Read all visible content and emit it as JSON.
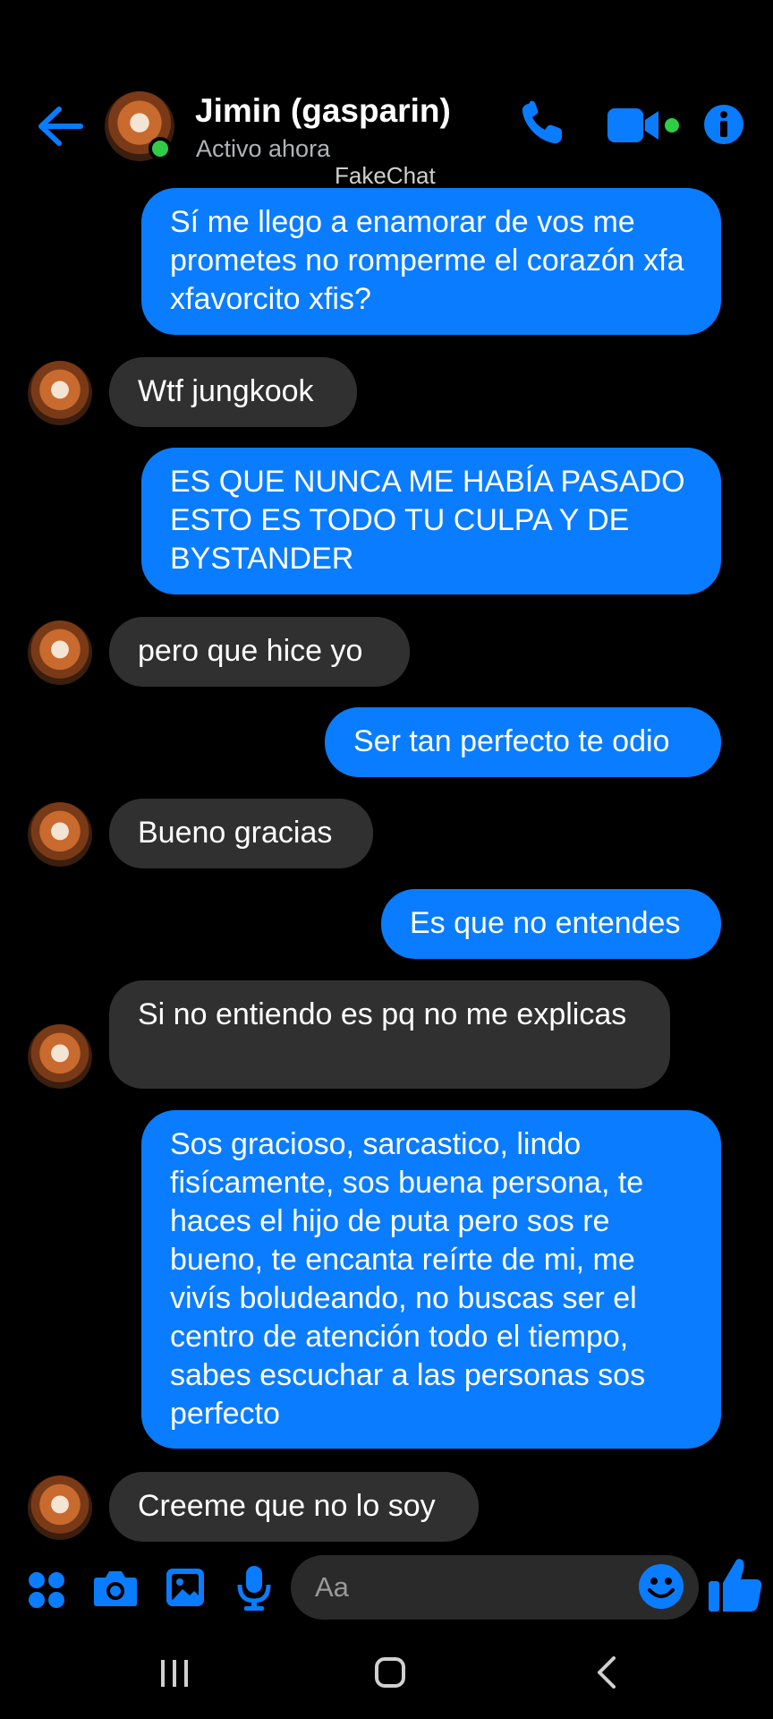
{
  "header": {
    "contact_name": "Jimin (gasparin)",
    "status": "Activo ahora",
    "watermark": "FakeChat"
  },
  "messages": [
    {
      "dir": "sent",
      "text": "Sí me llego a enamorar de vos me prometes no romperme el corazón xfa xfavorcito xfis?"
    },
    {
      "dir": "recv",
      "text": "Wtf jungkook"
    },
    {
      "dir": "sent",
      "text": "ES QUE NUNCA ME HABÍA PASADO ESTO ES TODO TU CULPA Y DE BYSTANDER"
    },
    {
      "dir": "recv",
      "text": "pero que hice yo"
    },
    {
      "dir": "sent",
      "text": "Ser tan perfecto te odio"
    },
    {
      "dir": "recv",
      "text": "Bueno gracias"
    },
    {
      "dir": "sent",
      "text": "Es que no entendes"
    },
    {
      "dir": "recv",
      "text": "Si no entiendo es pq no me explicas"
    },
    {
      "dir": "sent",
      "text": "Sos gracioso, sarcastico, lindo fisícamente, sos buena persona, te haces el hijo de puta pero sos re bueno, te encanta reírte de mi, me vivís boludeando, no buscas ser el centro de atención todo el tiempo, sabes escuchar a las personas sos perfecto"
    },
    {
      "dir": "recv",
      "text": "Creeme que no lo soy"
    }
  ],
  "composer": {
    "placeholder": "Aa"
  },
  "icons": {
    "back": "arrow-left-icon",
    "call": "phone-icon",
    "video": "video-camera-icon",
    "info": "info-icon",
    "apps": "four-dots-icon",
    "camera": "camera-icon",
    "gallery": "image-icon",
    "mic": "microphone-icon",
    "emoji": "smiley-icon",
    "like": "thumbs-up-icon"
  },
  "colors": {
    "accent": "#0a7cff",
    "sent_bubble": "#0a7cff",
    "received_bubble": "#303030",
    "online": "#31cc46",
    "background": "#000000"
  }
}
